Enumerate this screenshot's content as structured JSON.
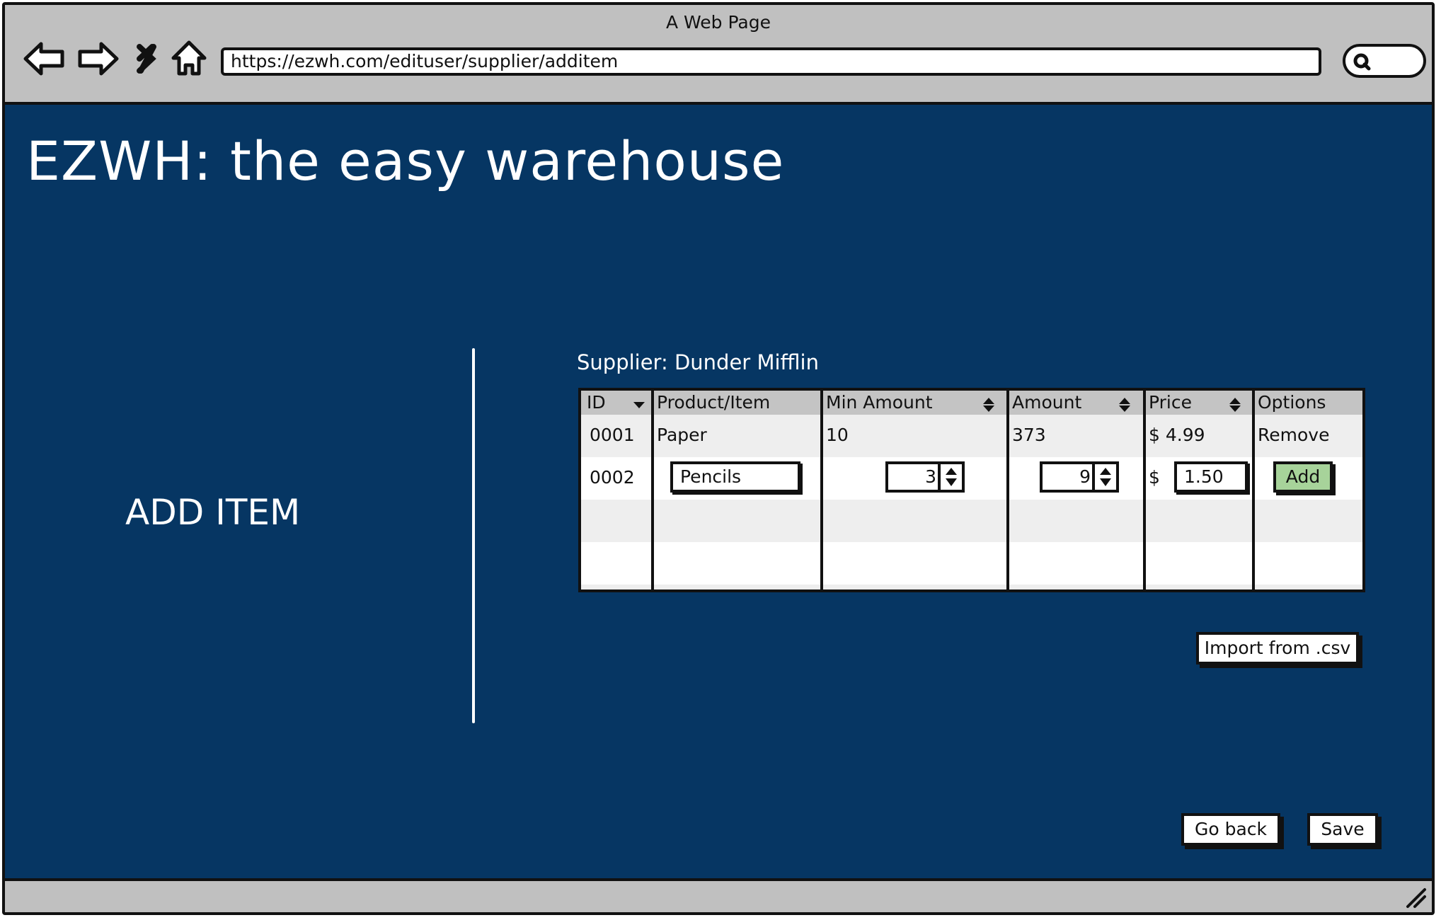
{
  "window": {
    "title": "A Web Page",
    "url": "https://ezwh.com/edituser/supplier/additem"
  },
  "app": {
    "title": "EZWH: the easy warehouse"
  },
  "page": {
    "section_label": "ADD ITEM",
    "supplier": "Supplier: Dunder Mifflin"
  },
  "table": {
    "headers": {
      "id": "ID",
      "product": "Product/Item",
      "min_amount": "Min Amount",
      "amount": "Amount",
      "price": "Price",
      "options": "Options"
    },
    "rows": [
      {
        "id": "0001",
        "product": "Paper",
        "min_amount": "10",
        "amount": "373",
        "price": "$ 4.99",
        "option": "Remove"
      }
    ],
    "new_row": {
      "id": "0002",
      "product_value": "Pencils",
      "min_amount_value": "3",
      "amount_value": "9",
      "currency": "$",
      "price_value": "1.50",
      "add_label": "Add"
    }
  },
  "buttons": {
    "import_csv": "Import from .csv",
    "go_back": "Go back",
    "save": "Save"
  },
  "colors": {
    "background": "#063663",
    "chrome": "#c0c0c0",
    "add_button": "#a7d39a"
  },
  "icons": [
    "back-arrow-icon",
    "forward-arrow-icon",
    "close-icon",
    "home-icon",
    "search-icon",
    "sort-desc-icon",
    "sort-updown-icon",
    "resize-grip-icon"
  ]
}
